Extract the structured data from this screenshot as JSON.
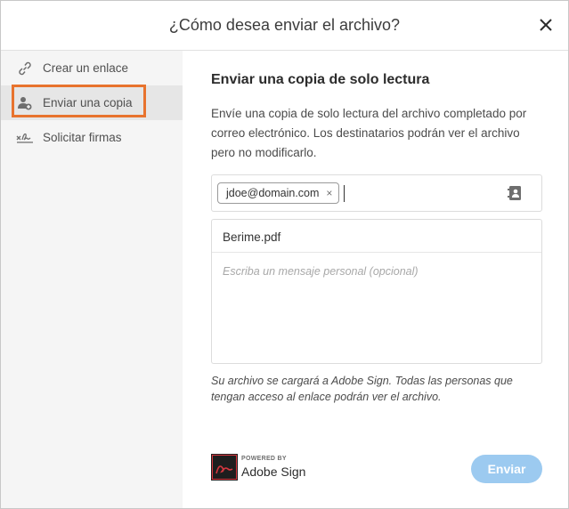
{
  "dialog": {
    "title": "¿Cómo desea enviar el archivo?",
    "close_icon": "close-icon"
  },
  "sidebar": {
    "items": [
      {
        "label": "Crear un enlace",
        "icon": "link-icon",
        "selected": false
      },
      {
        "label": "Enviar una copia",
        "icon": "add-person-icon",
        "selected": true
      },
      {
        "label": "Solicitar firmas",
        "icon": "signature-icon",
        "selected": false
      }
    ]
  },
  "main": {
    "heading": "Enviar una copia de solo lectura",
    "description": "Envíe una copia de solo lectura del archivo completado por correo electrónico. Los destinatarios podrán ver el archivo pero no modificarlo.",
    "recipients": [
      {
        "email": "jdoe@domain.com",
        "remove_label": "×"
      }
    ],
    "contacts_icon": "address-book-icon",
    "subject": "Berime.pdf",
    "message_placeholder": "Escriba un mensaje personal (opcional)",
    "note": "Su archivo se cargará a Adobe Sign. Todas las personas que tengan acceso al enlace podrán ver el archivo."
  },
  "footer": {
    "powered_by": "POWERED BY",
    "brand": "Adobe Sign",
    "send_label": "Enviar"
  },
  "colors": {
    "highlight": "#e8732e",
    "send_button": "#9ccaf0",
    "selected_bg": "#e6e6e6",
    "logo_red": "#d7373f"
  }
}
